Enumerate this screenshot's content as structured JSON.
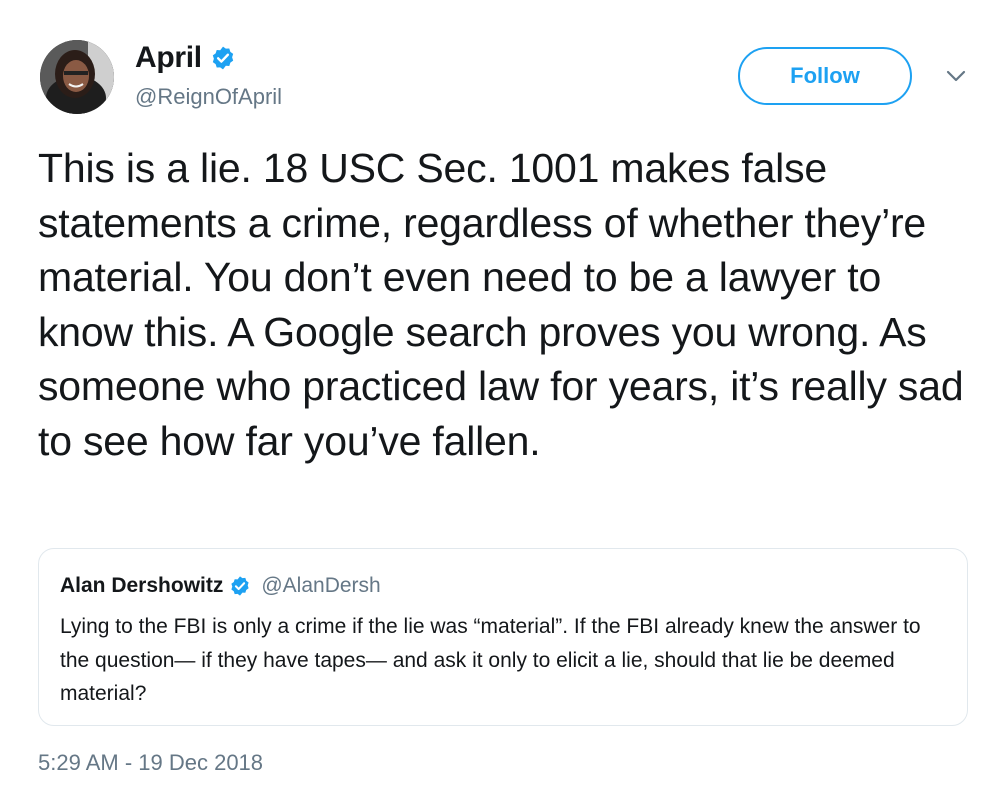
{
  "tweet": {
    "author": {
      "display_name": "April",
      "handle": "@ReignOfApril",
      "verified": true,
      "avatar": "profile-photo"
    },
    "follow_label": "Follow",
    "menu_icon": "chevron-down-icon",
    "text": "This is a lie. 18 USC Sec. 1001 makes false statements a crime, regardless of whether they’re material. You don’t even need to be a lawyer to know this. A Google search proves you wrong. As someone who practiced law for years, it’s really sad to see how far you’ve fallen.",
    "timestamp": "5:29 AM - 19 Dec 2018"
  },
  "quoted_tweet": {
    "display_name": "Alan Dershowitz",
    "handle": "@AlanDersh",
    "verified": true,
    "text": "Lying to the FBI is only a crime if the lie was “material”. If the FBI already knew the answer to the question— if they have tapes— and ask it only to elicit a lie, should that lie be deemed material?"
  },
  "colors": {
    "accent": "#1da1f2",
    "text_primary": "#14171a",
    "text_secondary": "#657786",
    "border": "#e1e8ed"
  }
}
